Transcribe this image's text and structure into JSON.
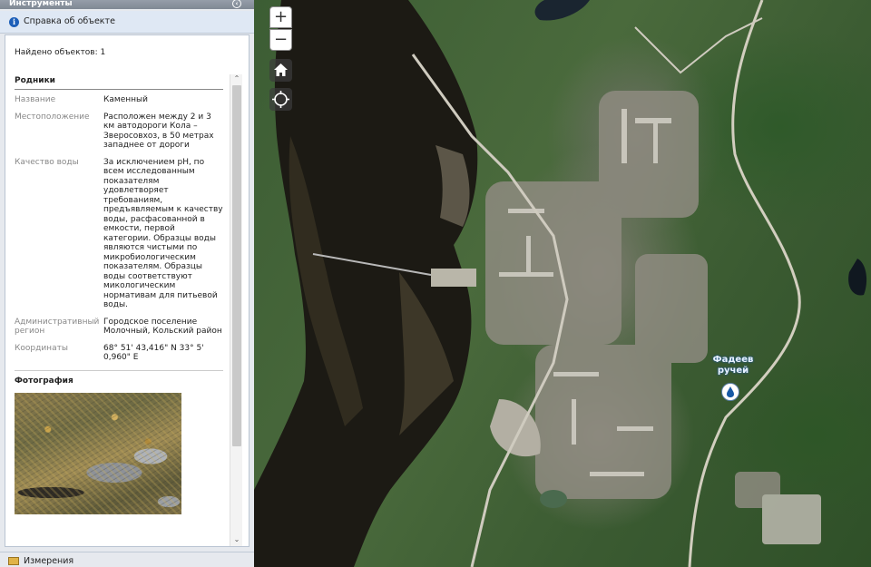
{
  "panel": {
    "header_title": "Инструменты",
    "collapse_glyph": "‹",
    "info_title": "Справка об объекте",
    "info_icon_glyph": "i",
    "found_text": "Найдено объектов: 1",
    "section_title": "Родники",
    "fields": [
      {
        "key": "Название",
        "value": "Каменный"
      },
      {
        "key": "Местоположение",
        "value": "Расположен между 2 и 3 км автодороги Кола – Зверосовхоз, в 50 метрах западнее от дороги"
      },
      {
        "key": "Качество воды",
        "value": "За исключением pH, по всем исследованным показателям удовлетворяет требованиям, предъявляемым к качеству воды, расфасованной в емкости, первой категории. Образцы воды являются чистыми по микробиологическим показателям. Образцы воды соответствуют микологическим нормативам для питьевой воды."
      },
      {
        "key": "Административный регион",
        "value": "Городское поселение Молочный, Кольский район"
      },
      {
        "key": "Координаты",
        "value": "68° 51' 43,416\" N 33° 5' 0,960\" E"
      }
    ],
    "photo_title": "Фотография",
    "scroll_up_glyph": "⌃",
    "scroll_down_glyph": "⌄",
    "measure_label": "Измерения"
  },
  "map": {
    "zoom_in": "+",
    "zoom_out": "−",
    "spring_label_line1": "Фадеев",
    "spring_label_line2": "ручей"
  }
}
